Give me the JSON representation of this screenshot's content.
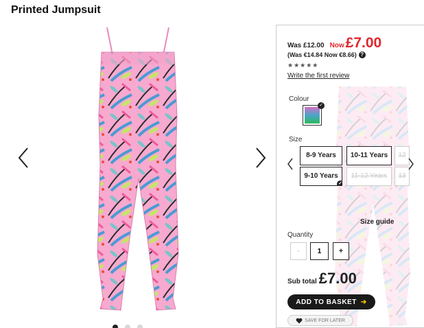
{
  "page": {
    "title": "Printed Jumpsuit"
  },
  "gallery": {
    "dots": 3,
    "active_dot": 1
  },
  "price": {
    "was_label": "Was £12.00",
    "now_label": "Now",
    "now_price": "£7.00",
    "euro_text": "(Was €14.84 Now €8.66)",
    "help_icon_text": "?",
    "stars_text": "★★★★★",
    "rating": 0,
    "review_link": "Write the first review"
  },
  "colour": {
    "label": "Colour",
    "swatch_icon": "colour-swatch",
    "selected": true
  },
  "size": {
    "label": "Size",
    "options": [
      {
        "label": "8-9 Years",
        "state": "available"
      },
      {
        "label": "10-11 Years",
        "state": "available"
      },
      {
        "label": "12",
        "state": "disabled"
      },
      {
        "label": "9-10 Years",
        "state": "selected"
      },
      {
        "label": "11-12 Years",
        "state": "disabled"
      },
      {
        "label": "13",
        "state": "disabled"
      }
    ],
    "guide_label": "Size guide"
  },
  "quantity": {
    "label": "Quantity",
    "minus": "-",
    "value": "1",
    "plus": "+"
  },
  "subtotal": {
    "label": "Sub total",
    "value": "£7.00"
  },
  "actions": {
    "add_to_basket": "ADD TO BASKET",
    "basket_arrow": "➔",
    "save_for_later": "SAVE FOR LATER"
  },
  "colors": {
    "price_red": "#e0262d",
    "button_dark": "#1a1a1a",
    "arrow_accent": "#f2c200"
  }
}
